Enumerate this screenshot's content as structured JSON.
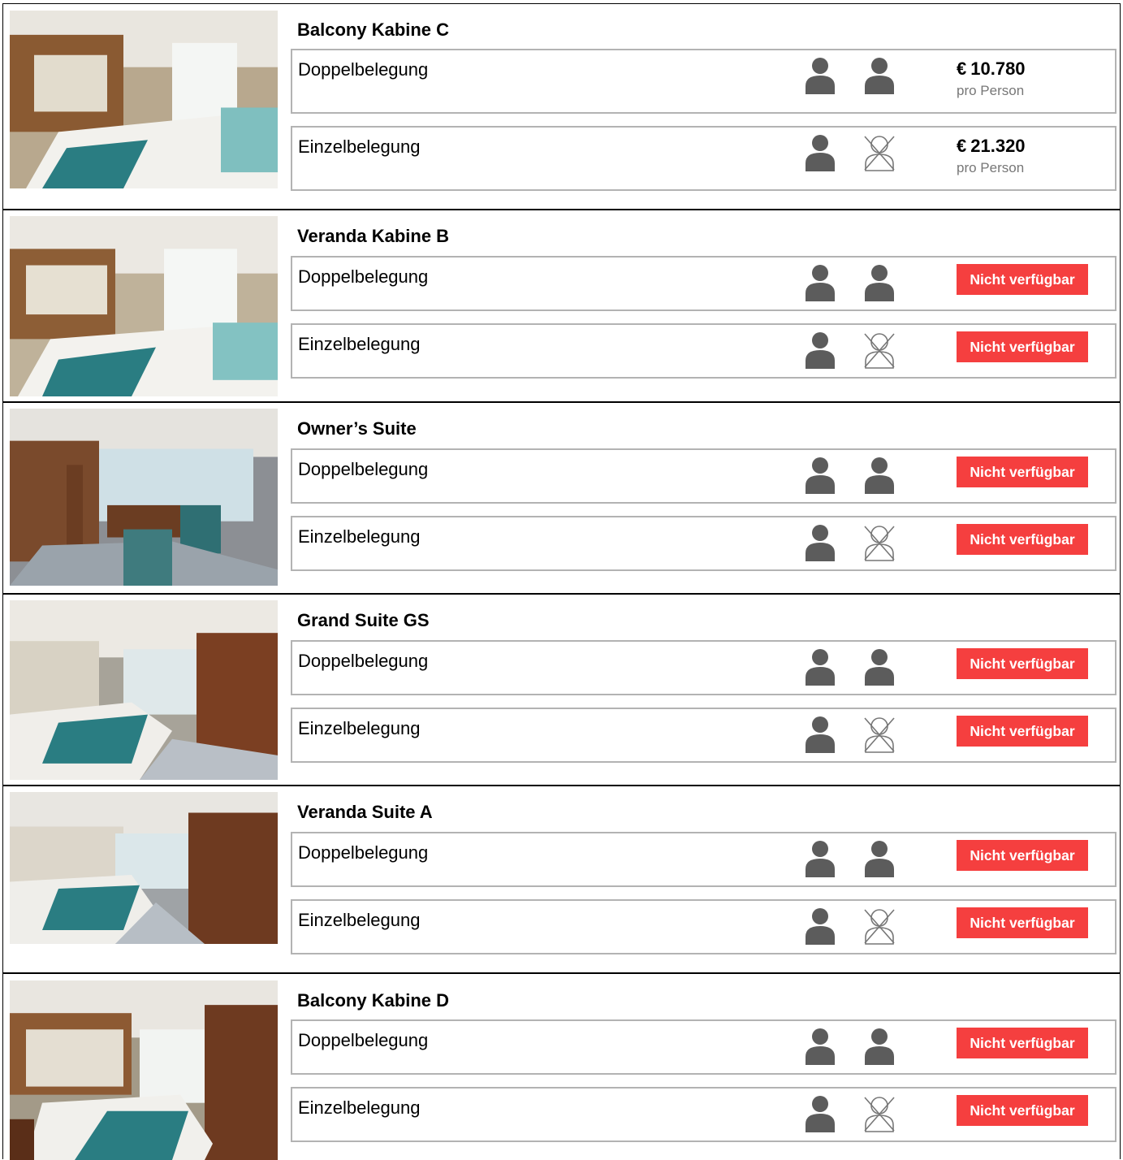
{
  "colors": {
    "accent_unavailable": "#f53f3f",
    "person_icon": "#5c5c5c",
    "border": "#b3b3b3"
  },
  "cabins": [
    {
      "name": "Balcony Kabine C",
      "options": [
        {
          "label": "Doppelbelegung",
          "persons": 2,
          "price": "10.780",
          "currency": "€",
          "unit": "pro Person"
        },
        {
          "label": "Einzelbelegung",
          "persons": 1,
          "price": "21.320",
          "currency": "€",
          "unit": "pro Person"
        }
      ]
    },
    {
      "name": "Veranda Kabine B",
      "options": [
        {
          "label": "Doppelbelegung",
          "persons": 2,
          "status": "Nicht verfügbar"
        },
        {
          "label": "Einzelbelegung",
          "persons": 1,
          "status": "Nicht verfügbar"
        }
      ]
    },
    {
      "name": "Owner’s Suite",
      "options": [
        {
          "label": "Doppelbelegung",
          "persons": 2,
          "status": "Nicht verfügbar"
        },
        {
          "label": "Einzelbelegung",
          "persons": 1,
          "status": "Nicht verfügbar"
        }
      ]
    },
    {
      "name": "Grand Suite GS",
      "options": [
        {
          "label": "Doppelbelegung",
          "persons": 2,
          "status": "Nicht verfügbar"
        },
        {
          "label": "Einzelbelegung",
          "persons": 1,
          "status": "Nicht verfügbar"
        }
      ]
    },
    {
      "name": "Veranda Suite A",
      "options": [
        {
          "label": "Doppelbelegung",
          "persons": 2,
          "status": "Nicht verfügbar"
        },
        {
          "label": "Einzelbelegung",
          "persons": 1,
          "status": "Nicht verfügbar"
        }
      ]
    },
    {
      "name": "Balcony Kabine D",
      "options": [
        {
          "label": "Doppelbelegung",
          "persons": 2,
          "status": "Nicht verfügbar"
        },
        {
          "label": "Einzelbelegung",
          "persons": 1,
          "status": "Nicht verfügbar"
        }
      ]
    }
  ]
}
